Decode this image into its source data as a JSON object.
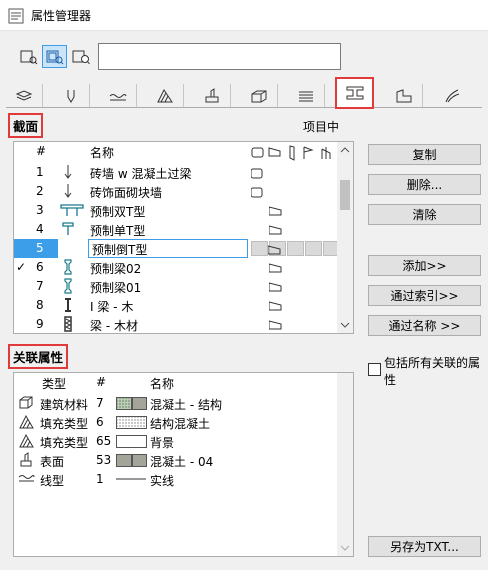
{
  "window": {
    "title": "属性管理器"
  },
  "search": {
    "value": ""
  },
  "modes": [
    {
      "icon": "view-all-icon",
      "active": false
    },
    {
      "icon": "view-in-use-icon",
      "active": true
    },
    {
      "icon": "view-search-icon",
      "active": false
    }
  ],
  "tabs": [
    {
      "icon": "layers-icon",
      "active": false
    },
    {
      "icon": "pens-icon",
      "active": false
    },
    {
      "icon": "line-types-icon",
      "active": false
    },
    {
      "icon": "fill-types-icon",
      "active": false
    },
    {
      "icon": "surfaces-icon",
      "active": false
    },
    {
      "icon": "building-materials-icon",
      "active": false
    },
    {
      "icon": "composites-icon",
      "active": false
    },
    {
      "icon": "profiles-icon",
      "active": true
    },
    {
      "icon": "zone-categories-icon",
      "active": false
    },
    {
      "icon": "mep-icon",
      "active": false
    }
  ],
  "section": {
    "label": "截面",
    "in_project_label": "项目中"
  },
  "list": {
    "header": {
      "num": "#",
      "name": "名称"
    },
    "rows": [
      {
        "num": "1",
        "name": "砖墙 w 混凝土过梁",
        "checked": false,
        "selected": false,
        "editing": false
      },
      {
        "num": "2",
        "name": "砖饰面砌块墙",
        "checked": false,
        "selected": false,
        "editing": false
      },
      {
        "num": "3",
        "name": "预制双T型",
        "checked": false,
        "selected": false,
        "editing": false
      },
      {
        "num": "4",
        "name": "预制单T型",
        "checked": false,
        "selected": false,
        "editing": false
      },
      {
        "num": "5",
        "name": "预制倒T型",
        "checked": false,
        "selected": true,
        "editing": true
      },
      {
        "num": "6",
        "name": "预制梁02",
        "checked": true,
        "selected": false,
        "editing": false
      },
      {
        "num": "7",
        "name": "预制梁01",
        "checked": false,
        "selected": false,
        "editing": false
      },
      {
        "num": "8",
        "name": "I 梁 - 木",
        "checked": false,
        "selected": false,
        "editing": false
      },
      {
        "num": "9",
        "name": "梁 - 木材",
        "checked": false,
        "selected": false,
        "editing": false
      }
    ]
  },
  "buttons": {
    "duplicate": "复制",
    "delete": "删除...",
    "purge": "清除",
    "add": "添加>>",
    "by_index": "通过索引>>",
    "by_name": "通过名称 >>",
    "save_txt": "另存为TXT..."
  },
  "related": {
    "label": "关联属性",
    "header": {
      "type": "类型",
      "num": "#",
      "name": "名称"
    },
    "rows": [
      {
        "icon": "building-material-icon",
        "type": "建筑材料",
        "num": "7",
        "swatch": "#b9cfb3",
        "swatch_pattern": "dots-green",
        "name": "混凝土 - 结构"
      },
      {
        "icon": "fill-type-icon",
        "type": "填充类型",
        "num": "6",
        "swatch": "#ffffff",
        "swatch_pattern": "dots",
        "name": "结构混凝土"
      },
      {
        "icon": "fill-type-icon",
        "type": "填充类型",
        "num": "65",
        "swatch": "#ffffff",
        "swatch_pattern": "empty",
        "name": "背景"
      },
      {
        "icon": "surface-icon",
        "type": "表面",
        "num": "53",
        "swatch": "#a3a49a",
        "swatch_pattern": "solid",
        "name": "混凝土 - 04"
      },
      {
        "icon": "line-type-icon",
        "type": "线型",
        "num": "1",
        "swatch": "",
        "swatch_pattern": "line",
        "name": "实线"
      }
    ],
    "include_all_label": "包括所有关联的属性",
    "include_all_checked": false
  }
}
